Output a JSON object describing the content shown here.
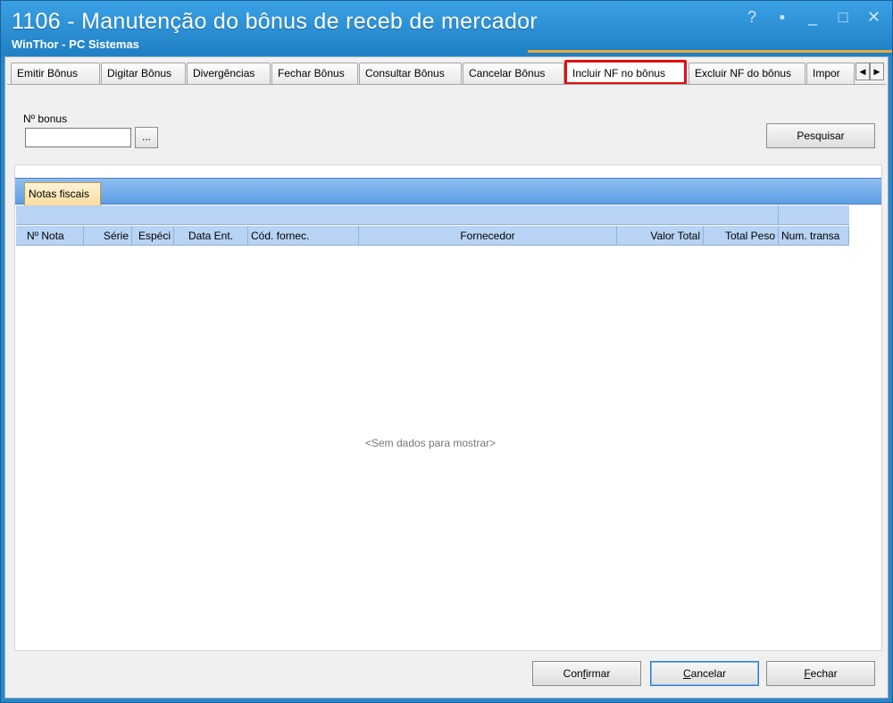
{
  "window": {
    "title": "1106 - Manutenção do bônus de receb de mercador",
    "subtitle": "WinThor - PC Sistemas",
    "controls": {
      "help": "?",
      "restore": "▪",
      "minimize": "_",
      "maximize": "□",
      "close": "✕"
    }
  },
  "tabs": [
    {
      "label": "Emitir Bônus"
    },
    {
      "label": "Digitar Bônus"
    },
    {
      "label": "Divergências"
    },
    {
      "label": "Fechar Bônus"
    },
    {
      "label": "Consultar Bônus"
    },
    {
      "label": "Cancelar Bônus"
    },
    {
      "label": "Incluir NF no bônus",
      "active": true
    },
    {
      "label": "Excluir NF do bônus"
    },
    {
      "label": "Impor"
    }
  ],
  "tab_scroll": {
    "left": "◀",
    "right": "▶"
  },
  "search": {
    "bonus_label": "Nº bonus",
    "bonus_value": "",
    "ellipsis_label": "...",
    "search_button": "Pesquisar"
  },
  "grid": {
    "tab_label": "Notas fiscais",
    "columns": [
      "Nº Nota",
      "Série",
      "Espéci",
      "Data Ent.",
      "Cód. fornec.",
      "Fornecedor",
      "Valor Total",
      "Total Peso",
      "Num. transa"
    ],
    "empty_message": "<Sem dados para mostrar>"
  },
  "footer": {
    "confirm": {
      "first": "Con",
      "accel": "f",
      "rest": "irmar"
    },
    "cancel": {
      "first": "",
      "accel": "C",
      "rest": "ancelar"
    },
    "close": {
      "first": "",
      "accel": "F",
      "rest": "echar"
    }
  },
  "colors": {
    "titlebar": "#2a86c8",
    "active_tab_highlight": "#e01010",
    "grid_header": "#b8d3f4",
    "grid_tab": "#fbdc9c",
    "accent_line": "#e7a93a"
  }
}
